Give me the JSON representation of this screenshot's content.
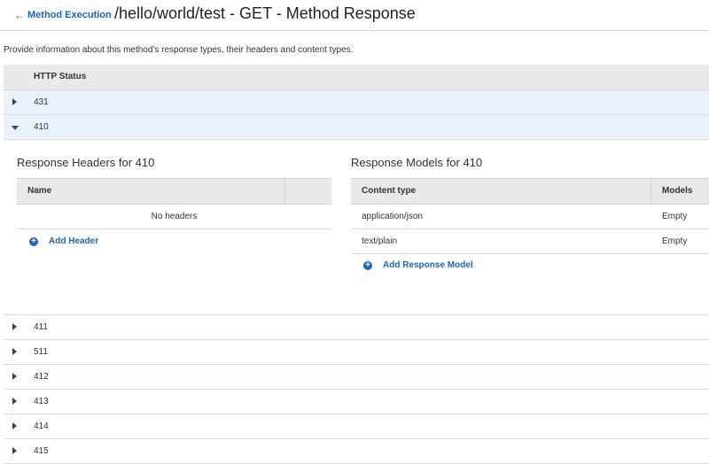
{
  "header": {
    "back_label": "Method Execution",
    "title": "/hello/world/test - GET - Method Response"
  },
  "description": "Provide information about this method's response types, their headers and content types.",
  "status_table": {
    "column": "HTTP Status",
    "rows_before": [
      {
        "code": "431",
        "state": "selected"
      },
      {
        "code": "410",
        "state": "expanded"
      }
    ],
    "rows_after": [
      {
        "code": "411"
      },
      {
        "code": "511"
      },
      {
        "code": "412"
      },
      {
        "code": "413"
      },
      {
        "code": "414"
      },
      {
        "code": "415"
      }
    ]
  },
  "expanded": {
    "headers_title": "Response Headers for 410",
    "headers_col_name": "Name",
    "headers_empty": "No headers",
    "add_header_label": "Add Header",
    "models_title": "Response Models for 410",
    "models_col_content_type": "Content type",
    "models_col_models": "Models",
    "models": [
      {
        "content_type": "application/json",
        "model": "Empty"
      },
      {
        "content_type": "text/plain",
        "model": "Empty"
      }
    ],
    "add_model_label": "Add Response Model"
  },
  "colors": {
    "link": "#1f64b8",
    "selected_row": "#eaf3fc",
    "header_bg": "#e9e9e9"
  }
}
